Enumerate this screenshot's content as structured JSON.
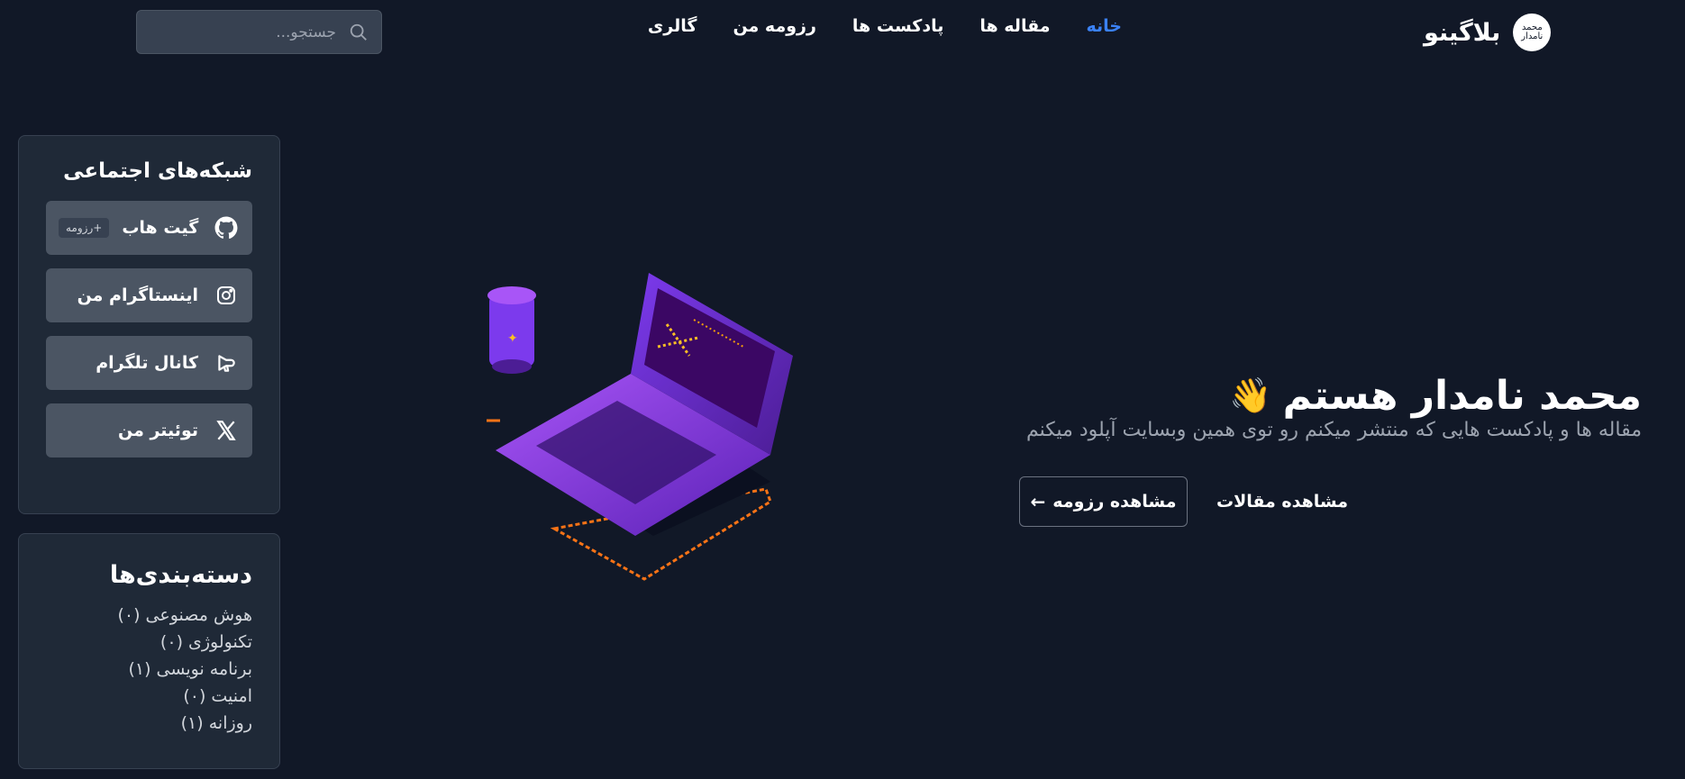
{
  "header": {
    "brand_name": "بلاگینو",
    "logo_text": "محمد نامدار",
    "nav": [
      {
        "label": "خانه",
        "active": true
      },
      {
        "label": "مقاله ها",
        "active": false
      },
      {
        "label": "پادکست ها",
        "active": false
      },
      {
        "label": "رزومه من",
        "active": false
      },
      {
        "label": "گالری",
        "active": false
      }
    ],
    "search": {
      "placeholder": "جستجو...",
      "icon": "search-icon"
    }
  },
  "social": {
    "title": "شبکه‌های اجتماعی",
    "items": [
      {
        "label": "گیت هاب",
        "badge": "+رزومه",
        "icon": "github-icon"
      },
      {
        "label": "اینستاگرام من",
        "icon": "instagram-icon"
      },
      {
        "label": "کانال تلگرام",
        "icon": "megaphone-icon"
      },
      {
        "label": "توئیتر من",
        "icon": "x-icon"
      }
    ]
  },
  "categories": {
    "title": "دسته‌بندی‌ها",
    "items": [
      "هوش مصنوعی (۰)",
      "تکنولوژی (۰)",
      "برنامه نویسی (۱)",
      "امنیت (۰)",
      "روزانه (۱)"
    ]
  },
  "hero": {
    "title": "محمد نامدار هستم",
    "emoji": "👋",
    "subtitle": "مقاله ها و پادکست هایی که منتشر میکنم رو توی همین وبسایت آپلود میکنم",
    "primary_button": "مشاهده مقالات",
    "secondary_button": "مشاهده رزومه",
    "secondary_arrow": "←"
  },
  "colors": {
    "background": "#111827",
    "card": "#1f2937",
    "accent": "#3b82f6",
    "button": "#4b5563"
  }
}
